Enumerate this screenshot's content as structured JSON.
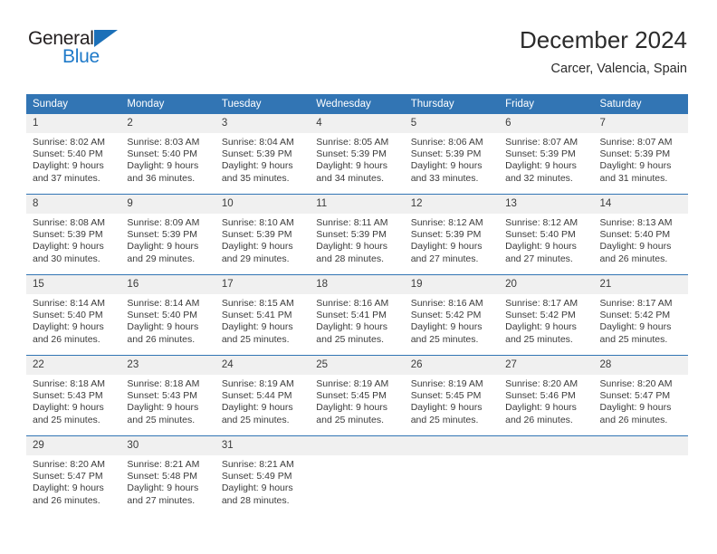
{
  "brand": {
    "name_top": "General",
    "name_bottom": "Blue",
    "accent_color": "#1c70b8",
    "dark_color": "#231f20"
  },
  "header": {
    "title": "December 2024",
    "subtitle": "Carcer, Valencia, Spain"
  },
  "theme": {
    "header_blue": "#3275b4",
    "daynum_gray": "#f0f0f0",
    "text_color": "#3b3b3b"
  },
  "calendar": {
    "weekday_headers": [
      "Sunday",
      "Monday",
      "Tuesday",
      "Wednesday",
      "Thursday",
      "Friday",
      "Saturday"
    ],
    "weeks": [
      [
        {
          "day": "1",
          "sunrise": "Sunrise: 8:02 AM",
          "sunset": "Sunset: 5:40 PM",
          "daylight_1": "Daylight: 9 hours",
          "daylight_2": "and 37 minutes."
        },
        {
          "day": "2",
          "sunrise": "Sunrise: 8:03 AM",
          "sunset": "Sunset: 5:40 PM",
          "daylight_1": "Daylight: 9 hours",
          "daylight_2": "and 36 minutes."
        },
        {
          "day": "3",
          "sunrise": "Sunrise: 8:04 AM",
          "sunset": "Sunset: 5:39 PM",
          "daylight_1": "Daylight: 9 hours",
          "daylight_2": "and 35 minutes."
        },
        {
          "day": "4",
          "sunrise": "Sunrise: 8:05 AM",
          "sunset": "Sunset: 5:39 PM",
          "daylight_1": "Daylight: 9 hours",
          "daylight_2": "and 34 minutes."
        },
        {
          "day": "5",
          "sunrise": "Sunrise: 8:06 AM",
          "sunset": "Sunset: 5:39 PM",
          "daylight_1": "Daylight: 9 hours",
          "daylight_2": "and 33 minutes."
        },
        {
          "day": "6",
          "sunrise": "Sunrise: 8:07 AM",
          "sunset": "Sunset: 5:39 PM",
          "daylight_1": "Daylight: 9 hours",
          "daylight_2": "and 32 minutes."
        },
        {
          "day": "7",
          "sunrise": "Sunrise: 8:07 AM",
          "sunset": "Sunset: 5:39 PM",
          "daylight_1": "Daylight: 9 hours",
          "daylight_2": "and 31 minutes."
        }
      ],
      [
        {
          "day": "8",
          "sunrise": "Sunrise: 8:08 AM",
          "sunset": "Sunset: 5:39 PM",
          "daylight_1": "Daylight: 9 hours",
          "daylight_2": "and 30 minutes."
        },
        {
          "day": "9",
          "sunrise": "Sunrise: 8:09 AM",
          "sunset": "Sunset: 5:39 PM",
          "daylight_1": "Daylight: 9 hours",
          "daylight_2": "and 29 minutes."
        },
        {
          "day": "10",
          "sunrise": "Sunrise: 8:10 AM",
          "sunset": "Sunset: 5:39 PM",
          "daylight_1": "Daylight: 9 hours",
          "daylight_2": "and 29 minutes."
        },
        {
          "day": "11",
          "sunrise": "Sunrise: 8:11 AM",
          "sunset": "Sunset: 5:39 PM",
          "daylight_1": "Daylight: 9 hours",
          "daylight_2": "and 28 minutes."
        },
        {
          "day": "12",
          "sunrise": "Sunrise: 8:12 AM",
          "sunset": "Sunset: 5:39 PM",
          "daylight_1": "Daylight: 9 hours",
          "daylight_2": "and 27 minutes."
        },
        {
          "day": "13",
          "sunrise": "Sunrise: 8:12 AM",
          "sunset": "Sunset: 5:40 PM",
          "daylight_1": "Daylight: 9 hours",
          "daylight_2": "and 27 minutes."
        },
        {
          "day": "14",
          "sunrise": "Sunrise: 8:13 AM",
          "sunset": "Sunset: 5:40 PM",
          "daylight_1": "Daylight: 9 hours",
          "daylight_2": "and 26 minutes."
        }
      ],
      [
        {
          "day": "15",
          "sunrise": "Sunrise: 8:14 AM",
          "sunset": "Sunset: 5:40 PM",
          "daylight_1": "Daylight: 9 hours",
          "daylight_2": "and 26 minutes."
        },
        {
          "day": "16",
          "sunrise": "Sunrise: 8:14 AM",
          "sunset": "Sunset: 5:40 PM",
          "daylight_1": "Daylight: 9 hours",
          "daylight_2": "and 26 minutes."
        },
        {
          "day": "17",
          "sunrise": "Sunrise: 8:15 AM",
          "sunset": "Sunset: 5:41 PM",
          "daylight_1": "Daylight: 9 hours",
          "daylight_2": "and 25 minutes."
        },
        {
          "day": "18",
          "sunrise": "Sunrise: 8:16 AM",
          "sunset": "Sunset: 5:41 PM",
          "daylight_1": "Daylight: 9 hours",
          "daylight_2": "and 25 minutes."
        },
        {
          "day": "19",
          "sunrise": "Sunrise: 8:16 AM",
          "sunset": "Sunset: 5:42 PM",
          "daylight_1": "Daylight: 9 hours",
          "daylight_2": "and 25 minutes."
        },
        {
          "day": "20",
          "sunrise": "Sunrise: 8:17 AM",
          "sunset": "Sunset: 5:42 PM",
          "daylight_1": "Daylight: 9 hours",
          "daylight_2": "and 25 minutes."
        },
        {
          "day": "21",
          "sunrise": "Sunrise: 8:17 AM",
          "sunset": "Sunset: 5:42 PM",
          "daylight_1": "Daylight: 9 hours",
          "daylight_2": "and 25 minutes."
        }
      ],
      [
        {
          "day": "22",
          "sunrise": "Sunrise: 8:18 AM",
          "sunset": "Sunset: 5:43 PM",
          "daylight_1": "Daylight: 9 hours",
          "daylight_2": "and 25 minutes."
        },
        {
          "day": "23",
          "sunrise": "Sunrise: 8:18 AM",
          "sunset": "Sunset: 5:43 PM",
          "daylight_1": "Daylight: 9 hours",
          "daylight_2": "and 25 minutes."
        },
        {
          "day": "24",
          "sunrise": "Sunrise: 8:19 AM",
          "sunset": "Sunset: 5:44 PM",
          "daylight_1": "Daylight: 9 hours",
          "daylight_2": "and 25 minutes."
        },
        {
          "day": "25",
          "sunrise": "Sunrise: 8:19 AM",
          "sunset": "Sunset: 5:45 PM",
          "daylight_1": "Daylight: 9 hours",
          "daylight_2": "and 25 minutes."
        },
        {
          "day": "26",
          "sunrise": "Sunrise: 8:19 AM",
          "sunset": "Sunset: 5:45 PM",
          "daylight_1": "Daylight: 9 hours",
          "daylight_2": "and 25 minutes."
        },
        {
          "day": "27",
          "sunrise": "Sunrise: 8:20 AM",
          "sunset": "Sunset: 5:46 PM",
          "daylight_1": "Daylight: 9 hours",
          "daylight_2": "and 26 minutes."
        },
        {
          "day": "28",
          "sunrise": "Sunrise: 8:20 AM",
          "sunset": "Sunset: 5:47 PM",
          "daylight_1": "Daylight: 9 hours",
          "daylight_2": "and 26 minutes."
        }
      ],
      [
        {
          "day": "29",
          "sunrise": "Sunrise: 8:20 AM",
          "sunset": "Sunset: 5:47 PM",
          "daylight_1": "Daylight: 9 hours",
          "daylight_2": "and 26 minutes."
        },
        {
          "day": "30",
          "sunrise": "Sunrise: 8:21 AM",
          "sunset": "Sunset: 5:48 PM",
          "daylight_1": "Daylight: 9 hours",
          "daylight_2": "and 27 minutes."
        },
        {
          "day": "31",
          "sunrise": "Sunrise: 8:21 AM",
          "sunset": "Sunset: 5:49 PM",
          "daylight_1": "Daylight: 9 hours",
          "daylight_2": "and 28 minutes."
        },
        {
          "day": "",
          "sunrise": "",
          "sunset": "",
          "daylight_1": "",
          "daylight_2": ""
        },
        {
          "day": "",
          "sunrise": "",
          "sunset": "",
          "daylight_1": "",
          "daylight_2": ""
        },
        {
          "day": "",
          "sunrise": "",
          "sunset": "",
          "daylight_1": "",
          "daylight_2": ""
        },
        {
          "day": "",
          "sunrise": "",
          "sunset": "",
          "daylight_1": "",
          "daylight_2": ""
        }
      ]
    ]
  }
}
